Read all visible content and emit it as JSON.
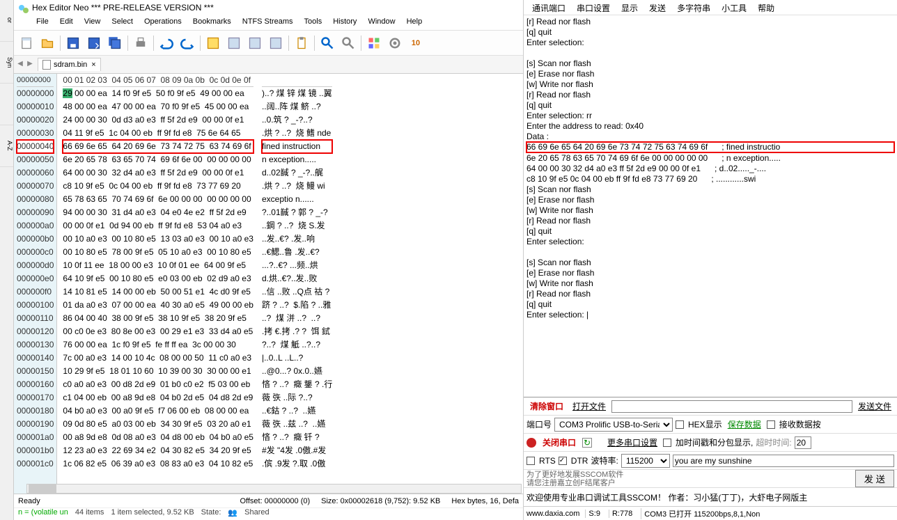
{
  "hex_editor": {
    "title": "Hex Editor Neo *** PRE-RELEASE VERSION ***",
    "menu": [
      "File",
      "Edit",
      "View",
      "Select",
      "Operations",
      "Bookmarks",
      "NTFS Streams",
      "Tools",
      "History",
      "Window",
      "Help"
    ],
    "tab": {
      "name": "sdram.bin"
    },
    "header_row": "00 01 02 03  04 05 06 07  08 09 0a 0b  0c 0d 0e 0f",
    "rows": [
      {
        "off": "00000000",
        "hl": true,
        "hex": "29 00 00 ea  14 f0 9f e5  50 f0 9f e5  49 00 00 ea",
        "asc": ")..? 煤 锌 煤 镜 ..翼",
        "first": true
      },
      {
        "off": "00000010",
        "hex": "48 00 00 ea  47 00 00 ea  70 f0 9f e5  45 00 00 ea",
        "asc": "..阔..阵 煤 鲚 ..?"
      },
      {
        "off": "00000020",
        "hex": "24 00 00 30  0d d3 a0 e3  ff 5f 2d e9  00 00 0f e1",
        "asc": "..0.筑 ? _-?..?"
      },
      {
        "off": "00000030",
        "hex": "04 11 9f e5  1c 04 00 eb  ff 9f fd e8  75 6e 64 65",
        "asc": ".烘 ? ..?  烧 鳍 nde"
      },
      {
        "off": "00000040",
        "row_hl": true,
        "hex": "66 69 6e 65  64 20 69 6e  73 74 72 75  63 74 69 6f",
        "asc": "fined instruction"
      },
      {
        "off": "00000050",
        "hex": "6e 20 65 78  63 65 70 74  69 6f 6e 00  00 00 00 00",
        "asc": "n exception....."
      },
      {
        "off": "00000060",
        "hex": "64 00 00 30  32 d4 a0 e3  ff 5f 2d e9  00 00 0f e1",
        "asc": "d..02馘 ? _-?..艉"
      },
      {
        "off": "00000070",
        "hex": "c8 10 9f e5  0c 04 00 eb  ff 9f fd e8  73 77 69 20",
        "asc": ".烘 ? ..?  烧 鳗 wi"
      },
      {
        "off": "00000080",
        "hex": "65 78 63 65  70 74 69 6f  6e 00 00 00  00 00 00 00",
        "asc": "exceptio n......"
      },
      {
        "off": "00000090",
        "hex": "94 00 00 30  31 d4 a0 e3  04 e0 4e e2  ff 5f 2d e9",
        "asc": "?..01馘 ? 郭 ? _-?"
      },
      {
        "off": "000000a0",
        "hex": "00 00 0f e1  0d 94 00 eb  ff 9f fd e8  53 04 a0 e3",
        "asc": "..鋼 ? ..?  烧 S.发"
      },
      {
        "off": "000000b0",
        "hex": "00 10 a0 e3  00 10 80 e5  13 03 a0 e3  00 10 a0 e3",
        "asc": "..发..€? .发..响"
      },
      {
        "off": "000000c0",
        "hex": "00 10 80 e5  78 00 9f e5  05 10 a0 e3  00 10 80 e5",
        "asc": "..€鳃..鲁 .发..€?"
      },
      {
        "off": "000000d0",
        "hex": "10 0f 11 ee  18 00 00 e3  10 0f 01 ee  64 00 9f e5",
        "asc": "...?..€? ...频..烘"
      },
      {
        "off": "000000e0",
        "hex": "64 10 9f e5  00 10 80 e5  e0 03 00 eb  02 d9 a0 e3",
        "asc": "d.烘..€?..发..败"
      },
      {
        "off": "000000f0",
        "hex": "14 10 81 e5  14 00 00 eb  50 00 51 e1  4c d0 9f e5",
        "asc": "..信 ..败 ..Q点 祜 ?"
      },
      {
        "off": "00000100",
        "hex": "01 da a0 e3  07 00 00 ea  40 30 a0 e5  49 00 00 eb",
        "asc": "跻 ? ..?  $.陷 ? ..雅"
      },
      {
        "off": "00000110",
        "hex": "86 04 00 40  38 00 9f e5  38 10 9f e5  38 20 9f e5",
        "asc": "..?  煤 洴 ..?  ..?"
      },
      {
        "off": "00000120",
        "hex": "00 c0 0e e3  80 8e 00 e3  00 29 e1 e3  33 d4 a0 e5",
        "asc": ".拷 €.拷 .? ?  饵 鉽"
      },
      {
        "off": "00000130",
        "hex": "76 00 00 ea  1c f0 9f e5  fe ff ff ea  3c 00 00 30",
        "asc": "?..?  煤 觝 ..?..?"
      },
      {
        "off": "00000140",
        "hex": "7c 00 a0 e3  14 00 10 4c  08 00 00 50  11 c0 a0 e3",
        "asc": "|..0..L ..L..?"
      },
      {
        "off": "00000150",
        "hex": "10 29 9f e5  18 01 10 60  10 39 00 30  30 00 00 e1",
        "asc": "..@0...? 0x.0..嬿"
      },
      {
        "off": "00000160",
        "hex": "c0 a0 a0 e3  00 d8 2d e9  01 b0 c0 e2  f5 03 00 eb",
        "asc": "悋 ? ..?  癥 鋬 ? .行"
      },
      {
        "off": "00000170",
        "hex": "c1 04 00 eb  00 a8 9d e8  04 b0 2d e5  04 d8 2d e9",
        "asc": "薇 矤 ..际 ?..?"
      },
      {
        "off": "00000180",
        "hex": "04 b0 a0 e3  00 a0 9f e5  f7 06 00 eb  08 00 00 ea",
        "asc": "..€鈷 ? ..?  ..嬿"
      },
      {
        "off": "00000190",
        "hex": "09 0d 80 e5  a0 03 00 eb  34 30 9f e5  03 20 a0 e1",
        "asc": "薇 矤 ..兹 ..?  ..嬿"
      },
      {
        "off": "000001a0",
        "hex": "00 a8 9d e8  0d 08 a0 e3  04 d8 00 eb  04 b0 a0 e5",
        "asc": "悋 ? ..?  癥 钎 ?"
      },
      {
        "off": "000001b0",
        "hex": "12 23 a0 e3  22 69 34 e2  04 30 82 e5  34 20 9f e5",
        "asc": "#发 \"4发 .0傲.#发"
      },
      {
        "off": "000001c0",
        "hex": "1c 06 82 e5  06 39 a0 e3  08 83 a0 e3  04 10 82 e5",
        "asc": ".傧 .9发 ?.取 .0傲"
      }
    ],
    "status_ready": "Ready",
    "status_offset": "Offset: 00000000 (0)",
    "status_size": "Size: 0x00002618 (9,752): 9.52 KB",
    "status_mode": "Hex bytes, 16, Defa",
    "status2": {
      "items": "44 items",
      "sel": "1 item selected, 9.52 KB",
      "state": "State:",
      "shared": "Shared"
    },
    "status2_prefix": "n = (volatile un"
  },
  "sscom": {
    "menu": [
      "通讯端口",
      "串口设置",
      "显示",
      "发送",
      "多字符串",
      "小工具",
      "帮助"
    ],
    "lines": [
      "[r] Read nor flash",
      "[q] quit",
      "Enter selection:",
      "",
      "[s] Scan nor flash",
      "[e] Erase nor flash",
      "[w] Write nor flash",
      "[r] Read nor flash",
      "[q] quit",
      "Enter selection: rr",
      "Enter the address to read: 0x40",
      "Data :"
    ],
    "hl_line": "66 69 6e 65 64 20 69 6e 73 74 72 75 63 74 69 6f      ; fined instructio",
    "lines2": [
      "6e 20 65 78 63 65 70 74 69 6f 6e 00 00 00 00 00      ; n exception.....",
      "64 00 00 30 32 d4 a0 e3 ff 5f 2d e9 00 00 0f e1      ; d..02....._-....",
      "c8 10 9f e5 0c 04 00 eb ff 9f fd e8 73 77 69 20      ; ............swi ",
      "[s] Scan nor flash",
      "[e] Erase nor flash",
      "[w] Write nor flash",
      "[r] Read nor flash",
      "[q] quit",
      "Enter selection:",
      "",
      "[s] Scan nor flash",
      "[e] Erase nor flash",
      "[w] Write nor flash",
      "[r] Read nor flash",
      "[q] quit",
      "Enter selection: |"
    ],
    "controls": {
      "clear": "清除窗口",
      "open_file": "打开文件",
      "send_file": "发送文件",
      "port_label": "端口号",
      "port_value": "COM3 Prolific USB-to-Seria",
      "hex_display": "HEX显示",
      "save_data": "保存数据",
      "recv_data": "接收数据按",
      "close_port": "关闭串口",
      "more_settings": "更多串口设置",
      "timestamp": "加时间戳和分包显示,",
      "timeout_label": "超时时间:",
      "timeout_value": "20",
      "rts": "RTS",
      "dtr": "DTR",
      "baud_label": "波特率:",
      "baud_value": "115200",
      "input_text": "you are my sunshine",
      "note1": "为了更好地发展SSCOM软件",
      "note2": "请您注册嘉立创F结尾客户",
      "send_btn": "发    送",
      "welcome": "欢迎使用专业串口调试工具SSCOM！   作者：习小猛(丁丁)，大虾电子网版主  "
    },
    "status": {
      "site": "www.daxia.com",
      "s": "S:9",
      "r": "R:778",
      "com": "COM3 已打开 115200bps,8,1,Non"
    }
  }
}
